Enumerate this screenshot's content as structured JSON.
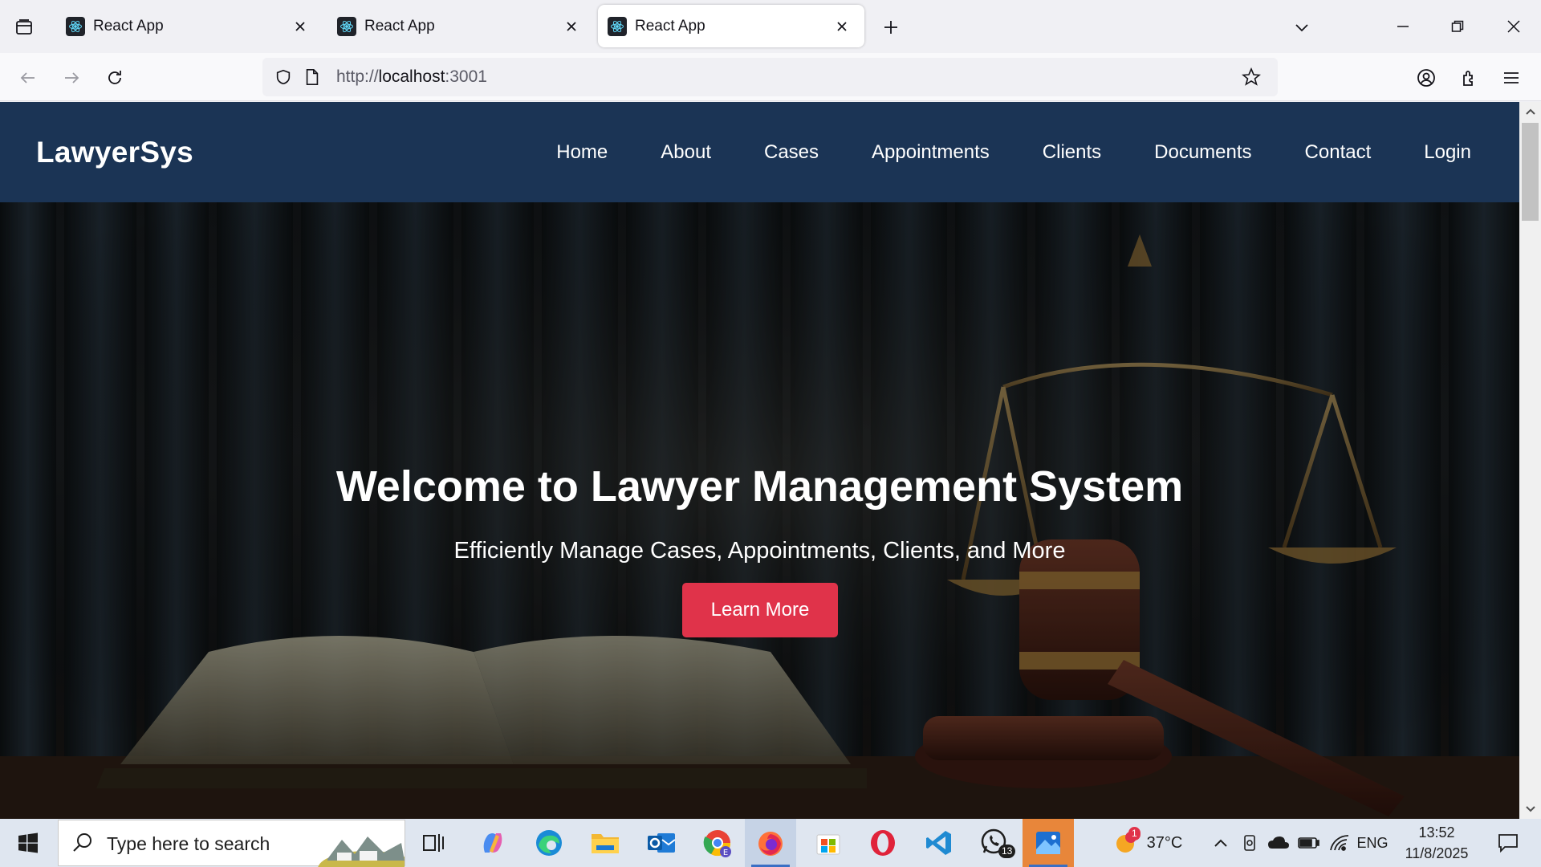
{
  "browser": {
    "tabs": [
      {
        "title": "React App",
        "active": false
      },
      {
        "title": "React App",
        "active": false
      },
      {
        "title": "React App",
        "active": true
      }
    ],
    "url": {
      "scheme": "http://",
      "host": "localhost",
      "port": ":3001"
    }
  },
  "site": {
    "logo": "LawyerSys",
    "menu": [
      "Home",
      "About",
      "Cases",
      "Appointments",
      "Clients",
      "Documents",
      "Contact",
      "Login"
    ],
    "hero": {
      "title": "Welcome to Lawyer Management System",
      "subtitle": "Efficiently Manage Cases, Appointments, Clients, and More",
      "button": "Learn More"
    }
  },
  "taskbar": {
    "search_placeholder": "Type here to search",
    "weather": {
      "temp": "37°C",
      "badge": "1"
    },
    "whatsapp_badge": "13",
    "language": "ENG",
    "time": "13:52",
    "date": "11/8/2025",
    "accent": "#3a6fc4"
  },
  "colors": {
    "header_bg": "#1b3455",
    "cta_bg": "#e0334a"
  }
}
